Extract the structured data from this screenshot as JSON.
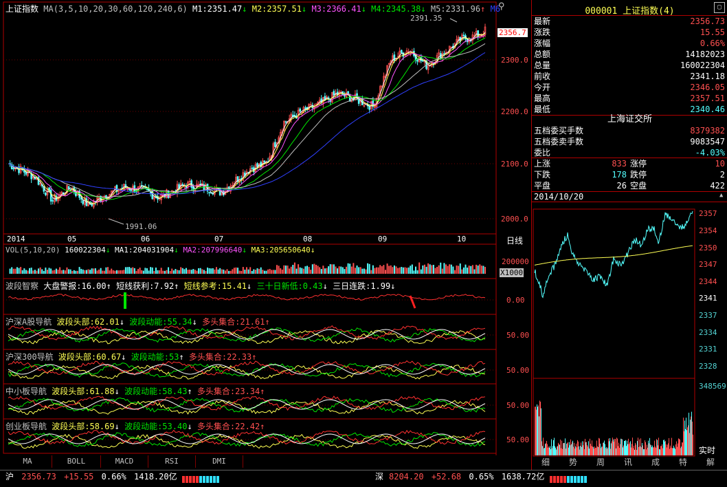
{
  "main_header": {
    "name": "上证指数",
    "ma_params": "MA(3,5,10,20,30,60,120,240,6)",
    "m1": "M1:2351.47",
    "m2": "M2:2357.51",
    "m3": "M3:2366.41",
    "m4": "M4:2345.38",
    "m5": "M5:2331.96",
    "m6": "M6"
  },
  "price_axis": [
    "2300.0",
    "2200.0",
    "2100.0",
    "2000.0"
  ],
  "price_current": "2356.7",
  "annot_high": "2391.35",
  "annot_low": "1991.06",
  "x_labels": [
    "2014",
    "05",
    "06",
    "07",
    "08",
    "09",
    "10"
  ],
  "period": "日线",
  "colors": {
    "up": "#ff5050",
    "down": "#54ffff",
    "grid": "#b00000",
    "ma1": "#ffffff",
    "ma2": "#ffff54",
    "ma3": "#ff54ff",
    "ma4": "#00e600",
    "ma5": "#c0c0c0",
    "ma6": "#3040ff"
  },
  "vol": {
    "header": "VOL(5,10,20)",
    "v": "160022304",
    "ma1": "MA1:204031904",
    "ma2": "MA2:207996640",
    "ma3": "MA3:205650640",
    "axis": "200000",
    "unit": "X1000"
  },
  "wave": {
    "title": "波段智察",
    "k1": "大盘警报:16.00",
    "k2": "短线获利:7.92",
    "k3": "短线参考:15.41",
    "k4": "三十日新低:0.43",
    "k5": "三日连跌:1.99",
    "axis": "0.00"
  },
  "panels": [
    {
      "title": "沪深A股导航",
      "a": "波段头部:62.01",
      "b": "波段动能:55.34",
      "c": "多头集合:21.61",
      "axis": "50.00"
    },
    {
      "title": "沪深300导航",
      "a": "波段头部:60.67",
      "b": "波段动能:53",
      "c": "多头集合:22.33",
      "axis": "50.00"
    },
    {
      "title": "中小板导航",
      "a": "波段头部:61.88",
      "b": "波段动能:58.43",
      "c": "多头集合:23.34",
      "axis": "50.00"
    },
    {
      "title": "创业板导航",
      "a": "波段头部:58.69",
      "b": "波段动能:53.40",
      "c": "多头集合:22.42",
      "axis": "50.00"
    }
  ],
  "bottom_tabs": [
    "MA",
    "BOLL",
    "MACD",
    "RSI",
    "DMI"
  ],
  "quote": {
    "code": "000001",
    "name": "上证指数(4)",
    "rows": [
      {
        "l": "最新",
        "v": "2356.73",
        "c": "red"
      },
      {
        "l": "涨跌",
        "v": "15.55",
        "c": "red"
      },
      {
        "l": "涨幅",
        "v": "0.66%",
        "c": "red"
      },
      {
        "l": "总额",
        "v": "14182023",
        "c": "white"
      },
      {
        "l": "总量",
        "v": "160022304",
        "c": "white"
      },
      {
        "l": "前收",
        "v": "2341.18",
        "c": "white"
      },
      {
        "l": "今开",
        "v": "2346.05",
        "c": "red"
      },
      {
        "l": "最高",
        "v": "2357.51",
        "c": "red"
      },
      {
        "l": "最低",
        "v": "2340.46",
        "c": "cyan"
      }
    ],
    "exchange": "上海证交所",
    "rows2": [
      {
        "l": "五档委买手数",
        "v": "8379382",
        "c": "red"
      },
      {
        "l": "五档委卖手数",
        "v": "9083547",
        "c": "white"
      },
      {
        "l": "委比",
        "v": "-4.03%",
        "c": "cyan"
      }
    ],
    "up_label": "上涨",
    "up": "833",
    "limit_up_label": "涨停",
    "limit_up": "10",
    "down_label": "下跌",
    "down": "178",
    "limit_down_label": "跌停",
    "limit_down": "2",
    "flat_label": "平盘",
    "flat": "26",
    "susp_label": "空盘",
    "susp": "422",
    "date": "2014/10/20",
    "intraday_axis": [
      "2357",
      "2354",
      "2350",
      "2347",
      "2344",
      "2341",
      "2337",
      "2334",
      "2331",
      "2328"
    ],
    "intraday_vol": "348569",
    "realtime": "实时",
    "tabs": [
      "细",
      "势",
      "周",
      "讯",
      "成",
      "特",
      "解"
    ]
  },
  "status": {
    "sh_label": "沪",
    "sh_price": "2356.73",
    "sh_chg": "+15.55",
    "sh_pct": "0.66%",
    "sh_amt": "1418.20亿",
    "sz_label": "深",
    "sz_price": "8204.20",
    "sz_chg": "+52.68",
    "sz_pct": "0.65%",
    "sz_amt": "1638.72亿"
  }
}
